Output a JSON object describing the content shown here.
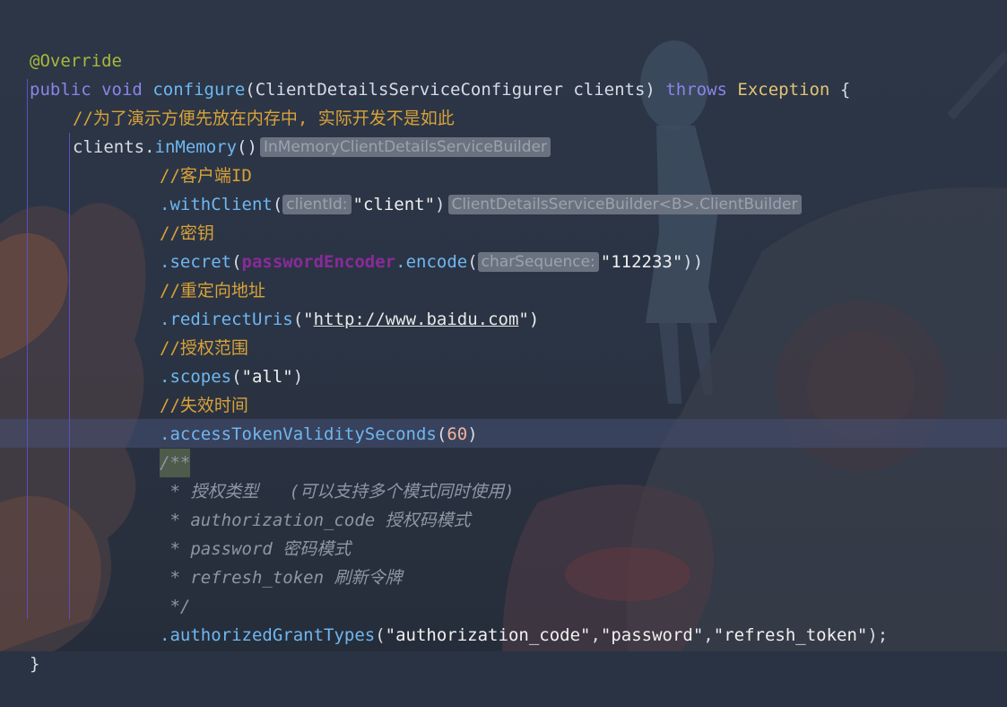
{
  "code": {
    "l1": {
      "annotation": "@Override"
    },
    "l2": {
      "kw_public": "public",
      "kw_void": "void",
      "method": "configure",
      "paren_open": "(",
      "param_type": "ClientDetailsServiceConfigurer",
      "param_name": "clients",
      "paren_close": ")",
      "kw_throws": "throws",
      "exception": "Exception",
      "brace": "{"
    },
    "l3": {
      "comment": "//为了演示方便先放在内存中, 实际开发不是如此"
    },
    "l4": {
      "receiver": "clients",
      "dot": ".",
      "method": "inMemory",
      "parens": "()",
      "type_hint": "InMemoryClientDetailsServiceBuilder"
    },
    "l5": {
      "comment": "//客户端ID"
    },
    "l6": {
      "method": ".withClient",
      "open": "(",
      "param_hint": "clientId:",
      "value": "\"client\"",
      "close": ")",
      "type_hint": "ClientDetailsServiceBuilder<B>.ClientBuilder"
    },
    "l7": {
      "comment": "//密钥"
    },
    "l8": {
      "method": ".secret",
      "open": "(",
      "field": "passwordEncoder",
      "method2": ".encode",
      "open2": "(",
      "param_hint": "charSequence:",
      "value": "\"112233\"",
      "close": "))"
    },
    "l9": {
      "comment": "//重定向地址"
    },
    "l10": {
      "method": ".redirectUris",
      "open": "(",
      "quote": "\"",
      "url": "http://www.baidu.com",
      "close": "\")"
    },
    "l11": {
      "comment": "//授权范围"
    },
    "l12": {
      "method": ".scopes",
      "open": "(",
      "value": "\"all\"",
      "close": ")"
    },
    "l13": {
      "comment": "//失效时间"
    },
    "l14": {
      "method": ".accessTokenValiditySeconds",
      "open": "(",
      "value": "60",
      "close": ")"
    },
    "l15": {
      "doc_start": "/**"
    },
    "l16": {
      "doc": " * 授权类型   (可以支持多个模式同时使用)"
    },
    "l17": {
      "doc": " * authorization_code 授权码模式"
    },
    "l18": {
      "doc": " * password 密码模式"
    },
    "l19": {
      "doc": " * refresh_token 刷新令牌"
    },
    "l20": {
      "doc_end": " */"
    },
    "l21": {
      "method": ".authorizedGrantTypes",
      "open": "(",
      "v1": "\"authorization_code\"",
      "c1": ",",
      "v2": "\"password\"",
      "c2": ",",
      "v3": "\"refresh_token\"",
      "close": ");"
    },
    "l22": {
      "brace": "}"
    }
  },
  "colors": {
    "keyword": "#8b84e8",
    "method": "#6fb7f2",
    "comment": "#d8a238",
    "annotation": "#a9b83c",
    "string": "#f0f0f0",
    "number": "#f0b4a0",
    "doc_comment": "#8e96a4",
    "background": "#2a3343"
  }
}
